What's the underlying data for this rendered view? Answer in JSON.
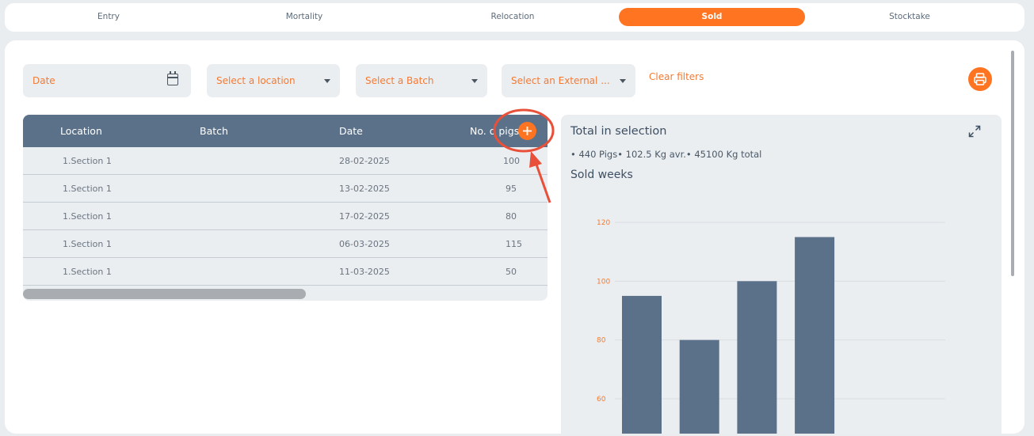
{
  "tabs": [
    {
      "label": "Entry"
    },
    {
      "label": "Mortality"
    },
    {
      "label": "Relocation"
    },
    {
      "label": "Sold"
    },
    {
      "label": "Stocktake"
    }
  ],
  "filters": {
    "date_placeholder": "Date",
    "location_placeholder": "Select a location",
    "batch_placeholder": "Select a Batch",
    "external_placeholder": "Select an External ...",
    "clear_label": "Clear filters"
  },
  "table": {
    "columns": [
      "Location",
      "Batch",
      "Date",
      "No. o"
    ],
    "pigs_header_tail": "pigs",
    "rows": [
      {
        "location": "1.Section 1",
        "batch": "",
        "date": "28-02-2025",
        "pigs": "100"
      },
      {
        "location": "1.Section 1",
        "batch": "",
        "date": "13-02-2025",
        "pigs": "95"
      },
      {
        "location": "1.Section 1",
        "batch": "",
        "date": "17-02-2025",
        "pigs": "80"
      },
      {
        "location": "1.Section 1",
        "batch": "",
        "date": "06-03-2025",
        "pigs": "115"
      },
      {
        "location": "1.Section 1",
        "batch": "",
        "date": "11-03-2025",
        "pigs": "50"
      }
    ]
  },
  "summary": {
    "title": "Total in selection",
    "stats": "• 440 Pigs• 102.5 Kg avr.• 45100 Kg total",
    "chart_title": "Sold weeks"
  },
  "chart_data": {
    "type": "bar",
    "title": "Sold weeks",
    "categories": [
      "",
      "",
      "",
      ""
    ],
    "values": [
      95,
      80,
      100,
      115
    ],
    "yticks": [
      60,
      80,
      100,
      120
    ],
    "ylim": [
      60,
      123
    ],
    "bar_color": "#5b7189",
    "tick_color": "#f47a32",
    "grid": true
  },
  "colors": {
    "accent": "#ff7420",
    "header": "#5b7189",
    "annotation": "#e8503a"
  },
  "icons": {
    "date": "calendar-icon",
    "print": "printer-icon",
    "add_column": "plus-icon",
    "expand": "expand-icon"
  }
}
